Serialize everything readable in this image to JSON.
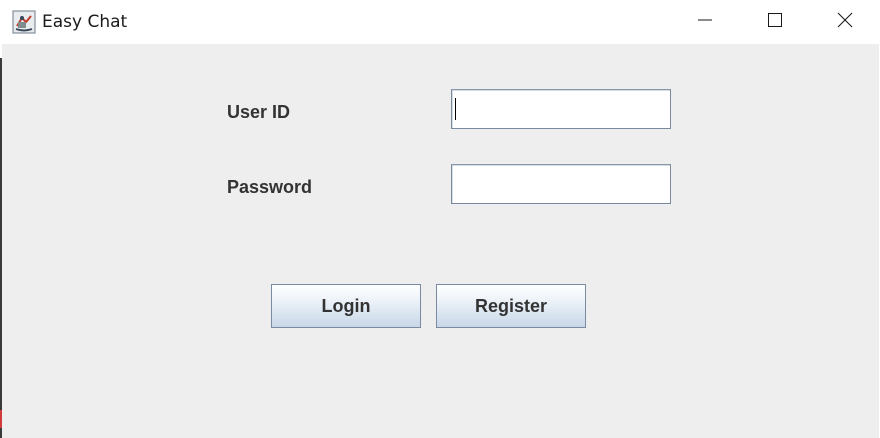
{
  "window": {
    "title": "Easy Chat",
    "icon": "java-coffee-cup-icon"
  },
  "titlebar_controls": {
    "minimize_icon": "minimize-icon",
    "maximize_icon": "maximize-icon",
    "close_icon": "close-icon"
  },
  "form": {
    "userid_label": "User ID",
    "userid_value": "",
    "password_label": "Password",
    "password_value": ""
  },
  "buttons": {
    "login_label": "Login",
    "register_label": "Register"
  },
  "colors": {
    "panel_background": "#eeeeee",
    "button_gradient_top": "#ffffff",
    "button_gradient_bottom": "#c8d6e7",
    "field_border": "#7a8a9e",
    "label_text": "#333333"
  }
}
